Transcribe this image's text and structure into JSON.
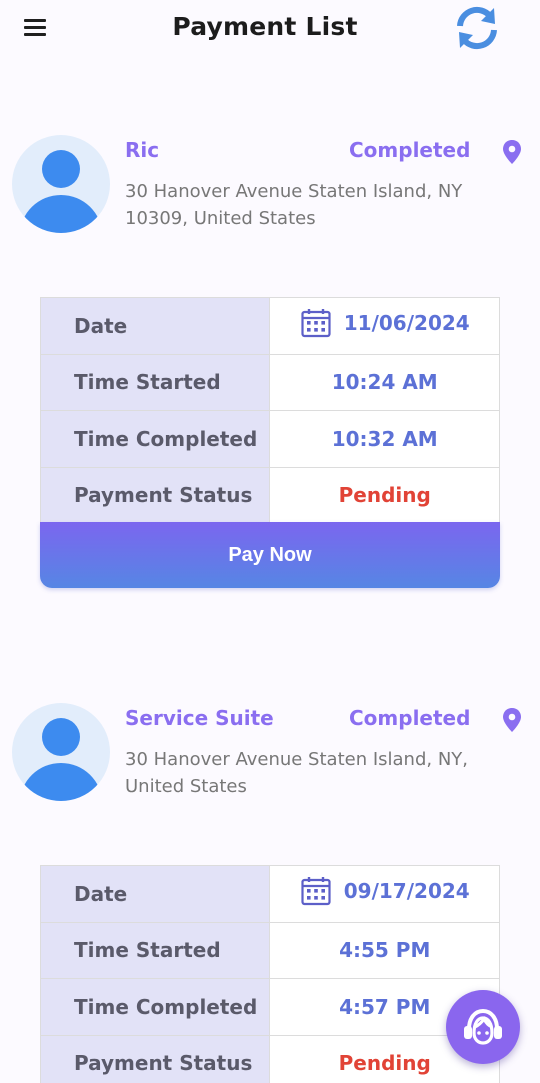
{
  "header": {
    "title": "Payment List"
  },
  "colors": {
    "accent": "#8a6ef0",
    "value_blue": "#5c71d6",
    "pending_red": "#e14336",
    "label_bg": "#e2e2f7"
  },
  "icons": {
    "menu": "hamburger-menu-icon",
    "refresh": "refresh-icon",
    "location": "location-pin-icon",
    "calendar": "calendar-icon",
    "support": "support-agent-icon",
    "avatar": "user-avatar-icon"
  },
  "payments": [
    {
      "name": "Ric",
      "status": "Completed",
      "address": "30 Hanover Avenue Staten Island, NY 10309, United States",
      "rows": [
        {
          "label": "Date",
          "value": "11/06/2024"
        },
        {
          "label": "Time Started",
          "value": "10:24 AM"
        },
        {
          "label": "Time Completed",
          "value": "10:32 AM"
        },
        {
          "label": "Payment Status",
          "value": "Pending"
        }
      ],
      "action_label": "Pay Now"
    },
    {
      "name": "Service Suite",
      "status": "Completed",
      "address": "30 Hanover Avenue Staten Island, NY, United States",
      "rows": [
        {
          "label": "Date",
          "value": "09/17/2024"
        },
        {
          "label": "Time Started",
          "value": "4:55 PM"
        },
        {
          "label": "Time Completed",
          "value": "4:57 PM"
        },
        {
          "label": "Payment Status",
          "value": "Pending"
        }
      ]
    }
  ]
}
